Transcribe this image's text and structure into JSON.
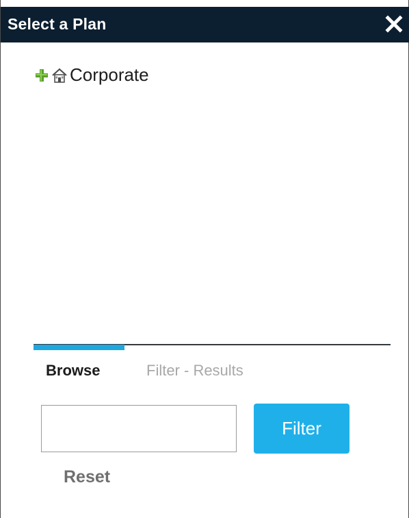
{
  "dialog": {
    "title": "Select a Plan",
    "close_icon": "close-icon"
  },
  "tree": {
    "items": [
      {
        "label": "Corporate",
        "expand_icon": "plus-icon",
        "icon": "home-icon"
      }
    ]
  },
  "tabs": [
    {
      "label": "Browse",
      "active": true
    },
    {
      "label": "Filter - Results",
      "active": false
    }
  ],
  "filter": {
    "input_value": "",
    "input_placeholder": "",
    "button_label": "Filter",
    "reset_label": "Reset"
  },
  "colors": {
    "titlebar": "#0b1f30",
    "accent": "#1fb0ea",
    "tab_active": "#1fa7e0",
    "expand_green": "#5aa02c"
  }
}
